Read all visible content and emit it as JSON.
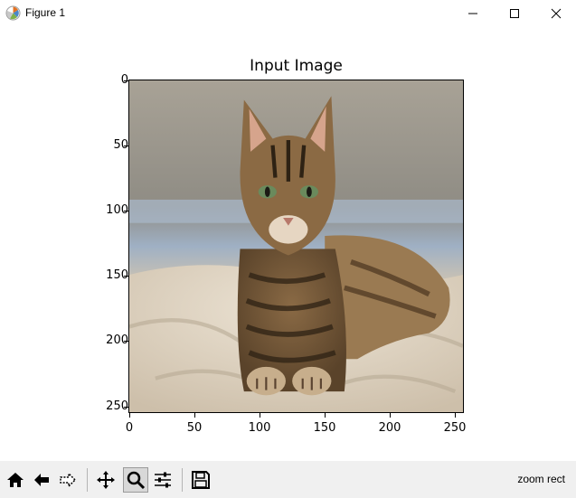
{
  "window": {
    "title": "Figure 1"
  },
  "plot": {
    "title": "Input Image",
    "y_ticks": [
      "0",
      "50",
      "100",
      "150",
      "200",
      "250"
    ],
    "x_ticks": [
      "0",
      "50",
      "100",
      "150",
      "200",
      "250"
    ]
  },
  "image": {
    "subject": "tabby cat lying on a blanket"
  },
  "toolbar": {
    "status": "zoom rect",
    "buttons": [
      "home-icon",
      "back-icon",
      "forward-icon",
      "pan-icon",
      "zoom-icon",
      "configure-subplots-icon",
      "save-icon"
    ],
    "active": "zoom-icon"
  }
}
